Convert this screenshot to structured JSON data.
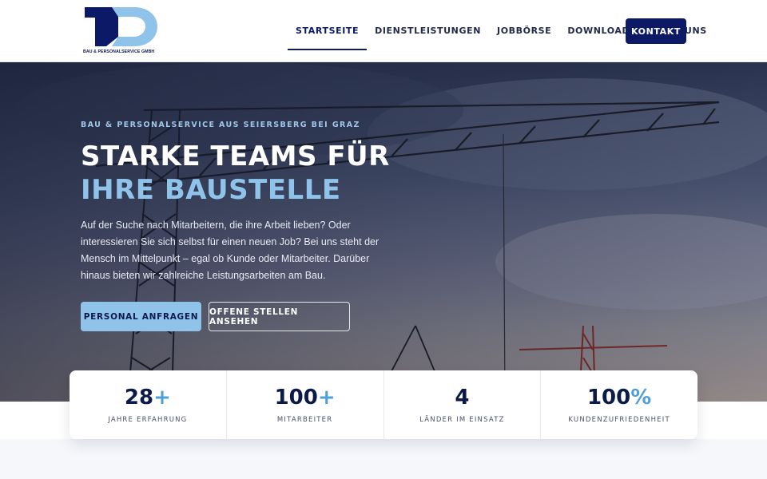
{
  "brand": {
    "logo_letters": "TD",
    "subtitle": "BAU & PERSONALSERVICE GMBH",
    "colors": {
      "navy": "#0c1966",
      "light_blue": "#8fc3ea"
    }
  },
  "nav": {
    "items": [
      {
        "label": "STARTSEITE",
        "active": true
      },
      {
        "label": "DIENSTLEISTUNGEN"
      },
      {
        "label": "JOBBÖRSE"
      },
      {
        "label": "DOWNLOADS"
      },
      {
        "label": "ÜBER UNS"
      }
    ],
    "cta": "KONTAKT"
  },
  "hero": {
    "eyebrow": "BAU & PERSONALSERVICE AUS SEIERSBERG BEI GRAZ",
    "headline_main": "STARKE TEAMS FÜR ",
    "headline_accent": "IHRE BAUSTELLE",
    "intro": "Auf der Suche nach Mitarbeitern, die ihre Arbeit lieben? Oder interessieren Sie sich selbst für einen neuen Job? Bei uns steht der Mensch im Mittelpunkt – egal ob Kunde oder Mitarbeiter. Darüber hinaus bieten wir zahlreiche Leistungsarbeiten am Bau.",
    "primary_button": "PERSONAL ANFRAGEN",
    "secondary_button": "OFFENE STELLEN ANSEHEN"
  },
  "stats": [
    {
      "value": "28",
      "suffix": "+",
      "label": "JAHRE ERFAHRUNG"
    },
    {
      "value": "100",
      "suffix": "+",
      "label": "MITARBEITER"
    },
    {
      "value": "4",
      "suffix": "",
      "label": "LÄNDER IM EINSATZ"
    },
    {
      "value": "100",
      "suffix": "%",
      "label": "KUNDENZUFRIEDENHEIT"
    }
  ]
}
